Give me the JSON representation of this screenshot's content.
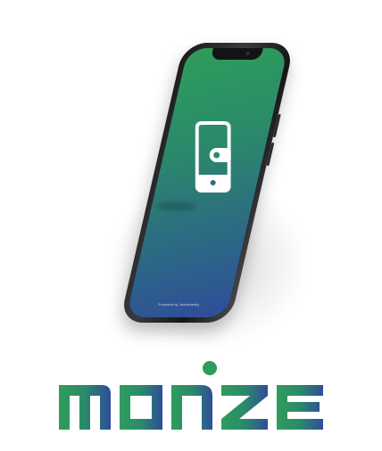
{
  "brand": {
    "name": "MONZE",
    "tagline": "Powered by Jeafrenesily",
    "colors": {
      "green": "#2e9d5b",
      "blue": "#2f4d9a",
      "teal": "#2b8a6a",
      "dot": "#2e9d5b"
    }
  },
  "phone": {
    "icon": "mobile-wallet-icon",
    "screen_gradient": [
      "#2e9d5b",
      "#2f4d9a"
    ]
  }
}
